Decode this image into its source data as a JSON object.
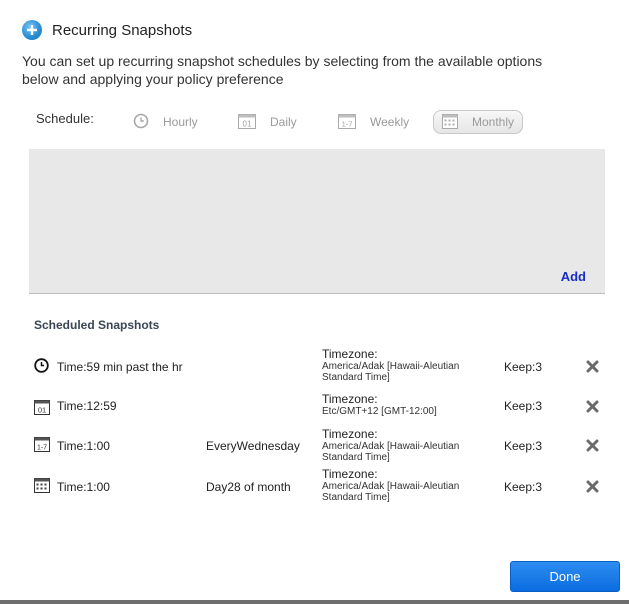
{
  "dialog": {
    "title": "Recurring Snapshots",
    "description": "You can set up recurring snapshot schedules by selecting from the available options below and applying your policy preference"
  },
  "schedule": {
    "label": "Schedule:",
    "options": [
      {
        "label": "Hourly",
        "icon": "clock-icon"
      },
      {
        "label": "Daily",
        "icon": "calendar-day-icon"
      },
      {
        "label": "Weekly",
        "icon": "calendar-week-icon"
      },
      {
        "label": "Monthly",
        "icon": "calendar-month-icon",
        "selected": true
      }
    ],
    "add_label": "Add"
  },
  "scheduled": {
    "title": "Scheduled Snapshots",
    "rows": [
      {
        "icon": "clock-icon",
        "time": "Time:59 min past the hr",
        "recurrence": "",
        "tz_label": "Timezone:",
        "tz_value": "America/Adak [Hawaii-Aleutian Standard Time]",
        "keep": "Keep:3"
      },
      {
        "icon": "calendar-day-icon",
        "time": "Time:12:59",
        "recurrence": "",
        "tz_label": "Timezone:",
        "tz_value": "Etc/GMT+12 [GMT-12:00]",
        "keep": "Keep:3"
      },
      {
        "icon": "calendar-week-icon",
        "time": "Time:1:00",
        "recurrence": "EveryWednesday",
        "tz_label": "Timezone:",
        "tz_value": "America/Adak [Hawaii-Aleutian Standard Time]",
        "keep": "Keep:3"
      },
      {
        "icon": "calendar-month-icon",
        "time": "Time:1:00",
        "recurrence": "Day28 of month",
        "tz_label": "Timezone:",
        "tz_value": "America/Adak [Hawaii-Aleutian Standard Time]",
        "keep": "Keep:3"
      }
    ]
  },
  "icon_text": {
    "daily": "01",
    "weekly": "1-7"
  },
  "footer": {
    "done_label": "Done"
  },
  "colors": {
    "accent": "#0a6ce0",
    "add_link": "#1a2dc2",
    "panel": "#e8e8e8"
  }
}
